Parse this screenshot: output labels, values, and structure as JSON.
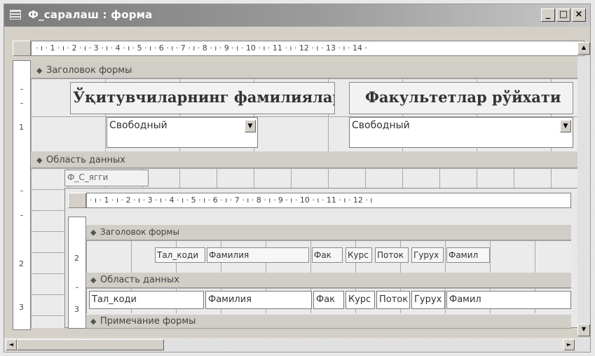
{
  "window": {
    "title": "Ф_саралаш : форма",
    "minimize_glyph": "_",
    "maximize_glyph": "□",
    "close_glyph": "×"
  },
  "ruler": {
    "outer": "· ı · 1 · ı · 2 · ı · 3 · ı · 4 · ı · 5 · ı · 6 · ı · 7 · ı · 8 · ı · 9 · ı · 10 · ı · 11 · ı · 12 · ı · 13 · ı · 14 ·",
    "inner": "· ı · 1 · ı · 2 · ı · 3 · ı · 4 · ı · 5 · ı · 6 · ı · 7 · ı · 8 · ı · 9 · ı · 10 · ı · 11 · ı · 12 · ı",
    "outer_vertical_marks": [
      "1",
      "2",
      "3"
    ],
    "inner_vertical_marks": [
      "2",
      "3"
    ]
  },
  "outer_form": {
    "header_section_label": "Заголовок формы",
    "detail_section_label": "Область данных",
    "header_label_left": "Ўқитувчиларнинг фамилиялари",
    "header_label_right": "Факультетлар рўйхати",
    "combo_left_value": "Свободный",
    "combo_right_value": "Свободный",
    "subform_control_label": "Ф_С_ягги"
  },
  "subform": {
    "header_section_label": "Заголовок формы",
    "detail_section_label": "Область данных",
    "footer_section_label": "Примечание формы",
    "header_labels": [
      "Тал_коди",
      "Фамилия",
      "Фак",
      "Курс",
      "Поток",
      "Гурух",
      "Фамил"
    ],
    "detail_fields": [
      "Тал_коди",
      "Фамилия",
      "Фак",
      "Курс",
      "Поток",
      "Гурух",
      "Фамил"
    ]
  },
  "icons": {
    "form": "form-icon",
    "section_arrow": "section-arrow-icon",
    "scroll_up": "scroll-up-icon",
    "scroll_down": "scroll-down-icon",
    "scroll_left": "scroll-left-icon",
    "scroll_right": "scroll-right-icon"
  }
}
